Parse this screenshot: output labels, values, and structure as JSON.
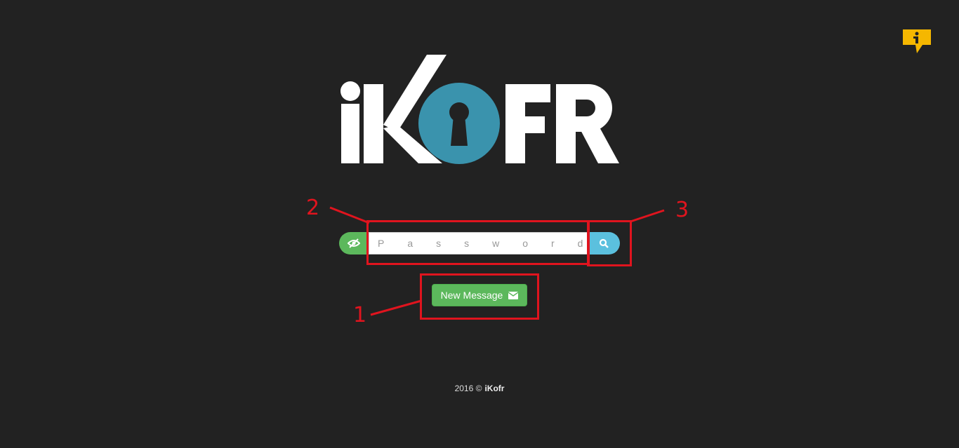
{
  "brand": {
    "logo_text": "iKOFR",
    "colors": {
      "keyhole_circle": "#3a93ad",
      "logo_text": "#ffffff",
      "info_badge": "#f5b700"
    }
  },
  "info": {
    "icon": "info-icon",
    "glyph": "i"
  },
  "search": {
    "placeholder": "Password",
    "eye_icon": "eye-slash-icon",
    "search_icon": "search-icon"
  },
  "new_message": {
    "label": "New Message",
    "icon": "envelope-icon"
  },
  "annotations": {
    "box1": "1",
    "box2": "2",
    "box3": "3"
  },
  "footer": {
    "year": "2016 ©",
    "brand": "iKofr"
  },
  "colors": {
    "background": "#222222",
    "green": "#5cb85c",
    "blue": "#5bc0de",
    "annotation_red": "#e0141e"
  }
}
